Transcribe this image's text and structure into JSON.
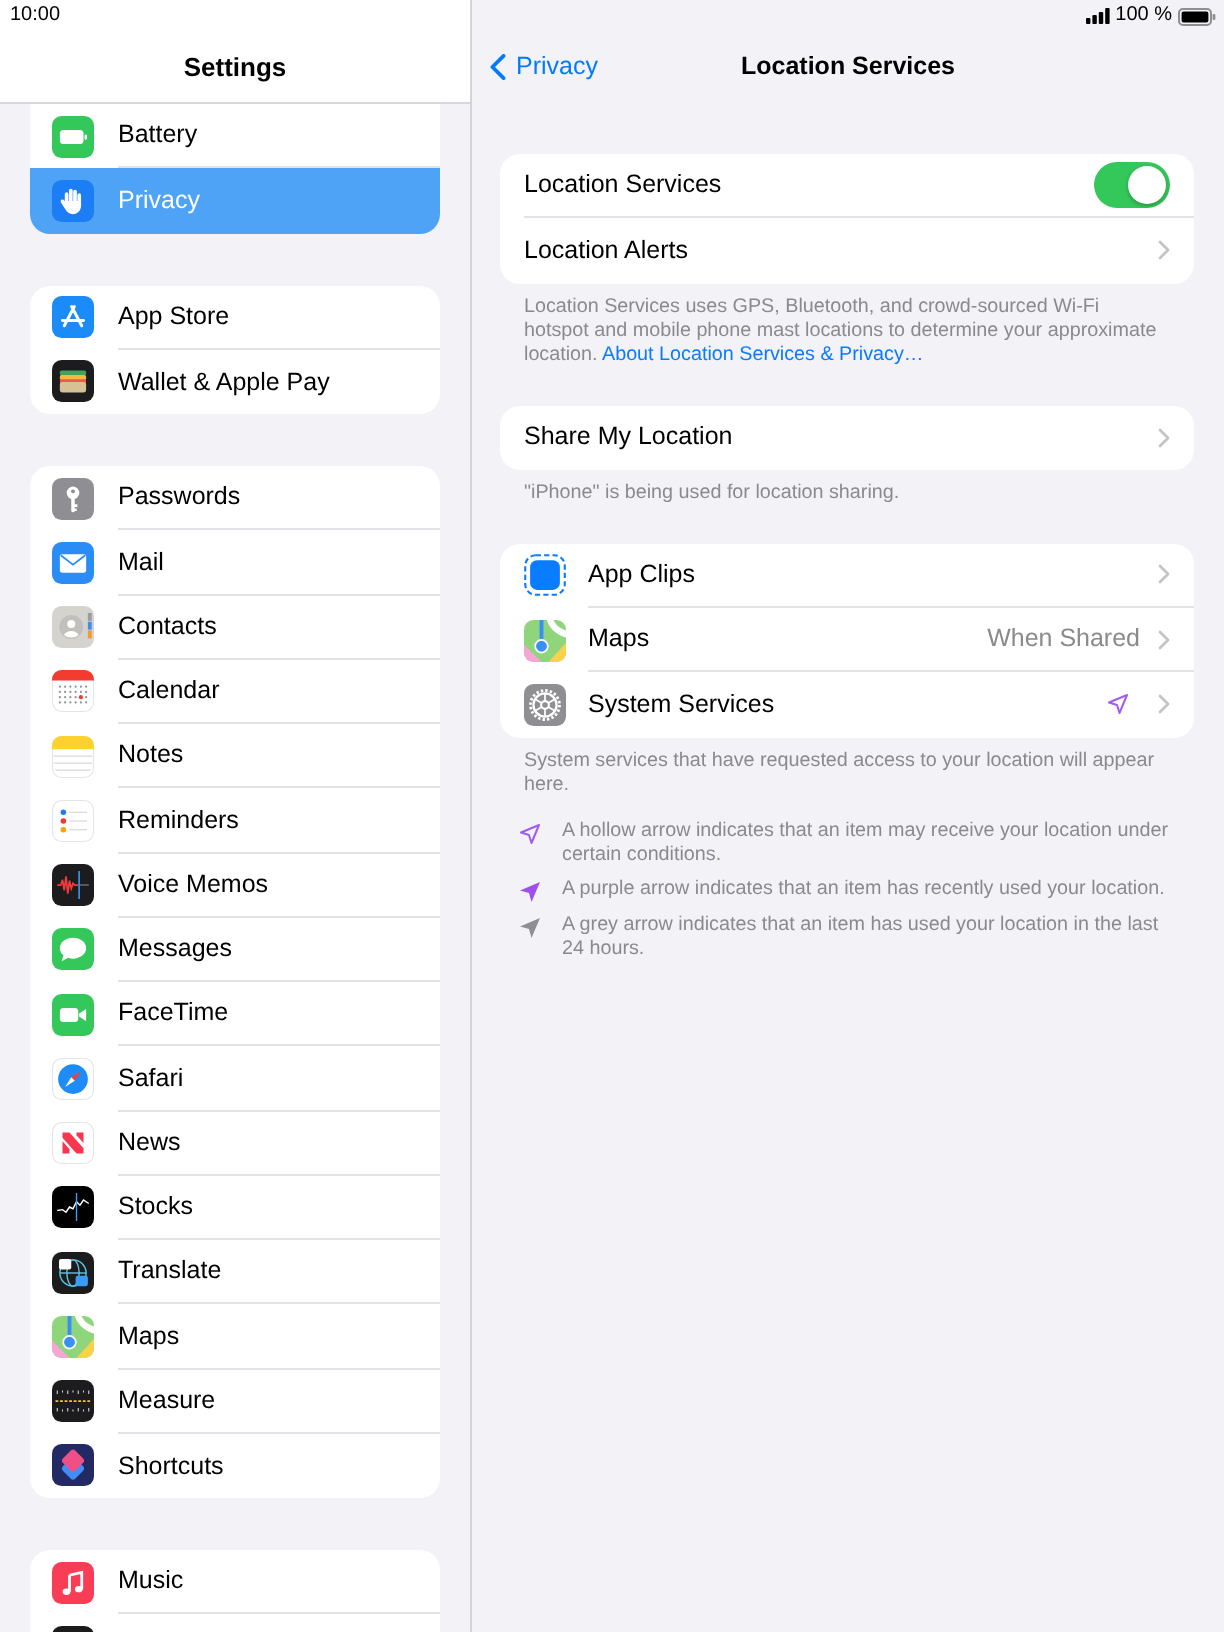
{
  "status_bar": {
    "time": "10:00",
    "battery_text": "100 %"
  },
  "sidebar": {
    "title": "Settings",
    "groups": [
      {
        "items": [
          {
            "label": "Battery",
            "selected": false
          },
          {
            "label": "Privacy",
            "selected": true
          }
        ]
      },
      {
        "items": [
          {
            "label": "App Store",
            "selected": false
          },
          {
            "label": "Wallet & Apple Pay",
            "selected": false
          }
        ]
      },
      {
        "items": [
          {
            "label": "Passwords",
            "selected": false
          },
          {
            "label": "Mail",
            "selected": false
          },
          {
            "label": "Contacts",
            "selected": false
          },
          {
            "label": "Calendar",
            "selected": false
          },
          {
            "label": "Notes",
            "selected": false
          },
          {
            "label": "Reminders",
            "selected": false
          },
          {
            "label": "Voice Memos",
            "selected": false
          },
          {
            "label": "Messages",
            "selected": false
          },
          {
            "label": "FaceTime",
            "selected": false
          },
          {
            "label": "Safari",
            "selected": false
          },
          {
            "label": "News",
            "selected": false
          },
          {
            "label": "Stocks",
            "selected": false
          },
          {
            "label": "Translate",
            "selected": false
          },
          {
            "label": "Maps",
            "selected": false
          },
          {
            "label": "Measure",
            "selected": false
          },
          {
            "label": "Shortcuts",
            "selected": false
          }
        ]
      },
      {
        "items": [
          {
            "label": "Music",
            "selected": false
          }
        ]
      }
    ]
  },
  "detail": {
    "back_label": "Privacy",
    "title": "Location Services",
    "sections": [
      {
        "rows": [
          {
            "kind": "toggle",
            "label": "Location Services",
            "on": true
          },
          {
            "kind": "link",
            "label": "Location Alerts"
          }
        ],
        "footer": {
          "text": "Location Services uses GPS, Bluetooth, and crowd-sourced Wi-Fi hotspot and mobile phone mast locations to determine your approximate location.",
          "link": "About Location Services & Privacy…"
        }
      },
      {
        "rows": [
          {
            "kind": "link",
            "label": "Share My Location"
          }
        ],
        "footer": {
          "text": "\"iPhone\" is being used for location sharing."
        }
      },
      {
        "rows": [
          {
            "kind": "link",
            "label": "App Clips"
          },
          {
            "kind": "link",
            "label": "Maps",
            "value": "When Shared"
          },
          {
            "kind": "link",
            "label": "System Services",
            "indicator": {
              "kind": "hollow"
            }
          }
        ],
        "footer": {
          "text": "System services that have requested access to your location will appear here."
        }
      }
    ],
    "legend": [
      {
        "kind": "hollow",
        "text": "A hollow arrow indicates that an item may receive your location under certain conditions."
      },
      {
        "kind": "purple",
        "text": "A purple arrow indicates that an item has recently used your location."
      },
      {
        "kind": "grey",
        "text": "A grey arrow indicates that an item has used your location in the last 24 hours."
      }
    ]
  }
}
